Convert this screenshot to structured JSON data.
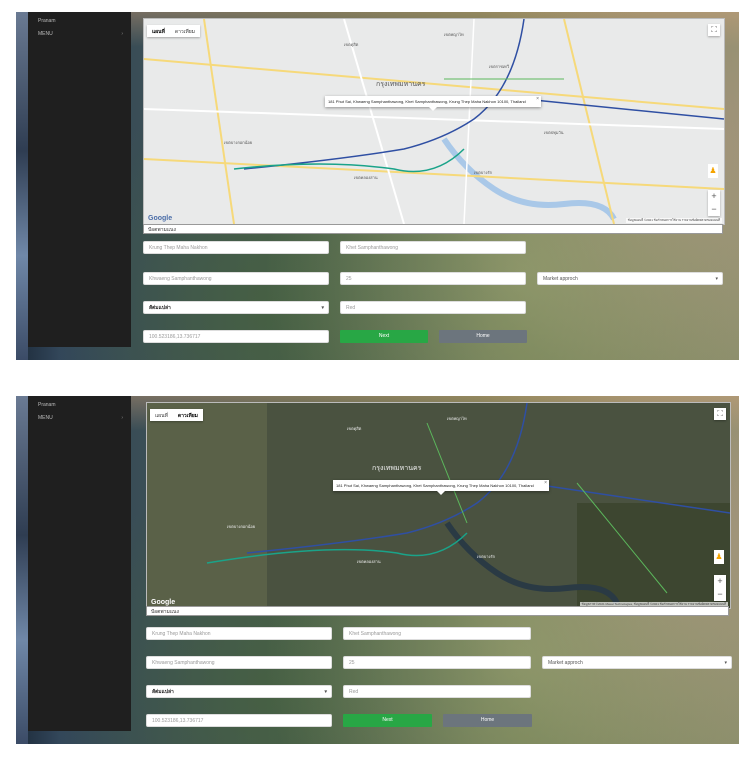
{
  "sidebar": {
    "brand": "Pranam",
    "menu": "MENU",
    "arrow": "›"
  },
  "map": {
    "type_map": "แผนที่",
    "type_sat": "ดาวเทียม",
    "fullscreen": "⛶",
    "pegman": "♟",
    "zoom_in": "+",
    "zoom_out": "−",
    "google": "Google",
    "attribution_top": "ข้อมูลแผนที่ ©2021   ข้อกำหนดการใช้งาน   รายงานข้อผิดพลาดของแผนที่",
    "attribution_bottom": "ข้อมูลภาพ ©2021 Maxar Technologies, ข้อมูลแผนที่ ©2021   ข้อกำหนดการใช้งาน   รายงานข้อผิดพลาดของแผนที่",
    "info_close": "×",
    "info_text": "181 Phut Sai, Khwaeng Samphanthawong, Khet Samphanthawong, Krung Thep Maha Nakhon 10100, Thailand",
    "labels": [
      "กรุงเทพมหานคร",
      "เขตดุสิต",
      "เขตพญาไท",
      "เขตราชเทวี",
      "เขตบางกอกน้อย",
      "เขตคลองสาน",
      "เขตบางรัก",
      "เขตปทุมวัน"
    ]
  },
  "position_bar": "ปัอตพามแนง",
  "form": {
    "province": "Krung Thep Maha Nakhon",
    "district": "Khet Samphanthawong",
    "subdistrict": "Khwaeng Samphanthawong",
    "number": "25",
    "approach": "Market approch",
    "dropdown": "สัต่มแปล่า",
    "color": "Red",
    "coords": "100.523186,13.736717",
    "next": "Next",
    "home": "Home",
    "chevron": "▾"
  }
}
